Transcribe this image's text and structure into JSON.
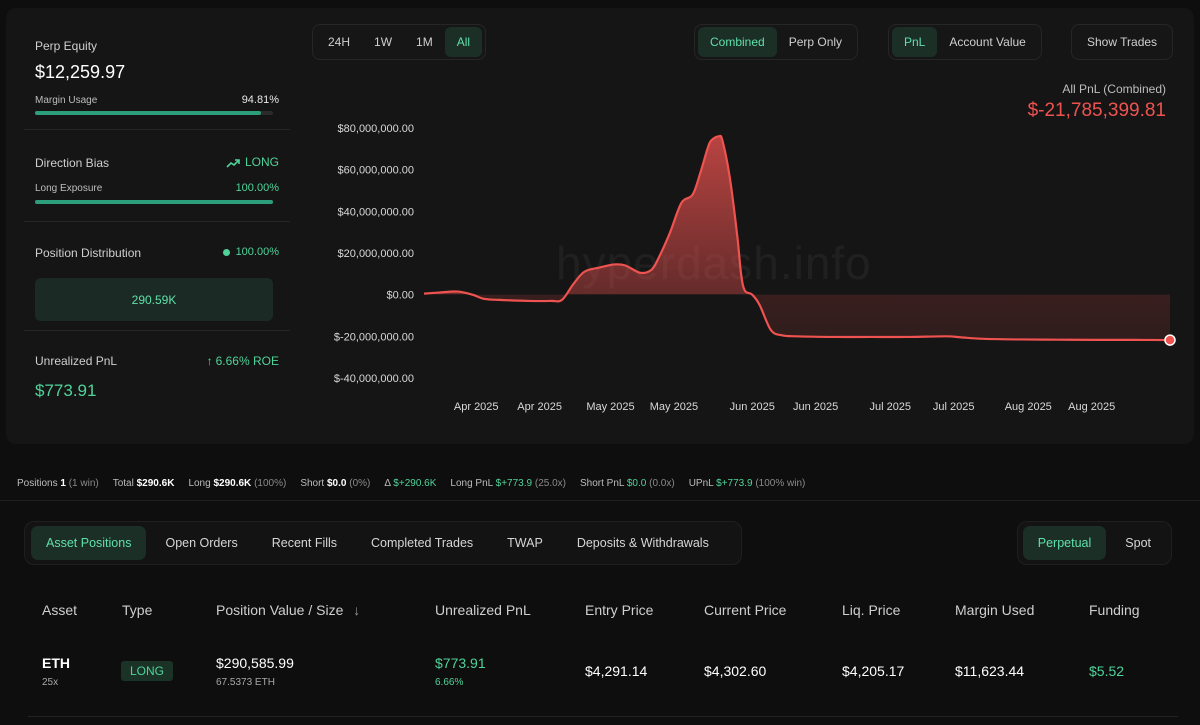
{
  "left_panel": {
    "perp_equity_label": "Perp Equity",
    "perp_equity_value": "$12,259.97",
    "margin_usage_label": "Margin Usage",
    "margin_usage_value": "94.81%",
    "margin_usage_fraction": 0.9481,
    "direction_bias_label": "Direction Bias",
    "direction_bias_value": "LONG",
    "long_exposure_label": "Long Exposure",
    "long_exposure_value": "100.00%",
    "long_exposure_fraction": 1.0,
    "position_distribution_label": "Position Distribution",
    "position_distribution_value": "100.00%",
    "position_distribution_amount": "290.59K",
    "unrealized_pnl_label": "Unrealized PnL",
    "roe_value": "6.66% ROE",
    "unrealized_pnl_value": "$773.91"
  },
  "chart_controls": {
    "time_ranges": [
      "24H",
      "1W",
      "1M",
      "All"
    ],
    "active_time_range": "All",
    "modes": [
      "Combined",
      "Perp Only"
    ],
    "active_mode": "Combined",
    "metrics": [
      "PnL",
      "Account Value"
    ],
    "active_metric": "PnL",
    "show_trades_label": "Show Trades"
  },
  "pnl_caption": "All PnL (Combined)",
  "pnl_value": "$-21,785,399.81",
  "watermark_text": "hyperdash.info",
  "chart_data": {
    "type": "area",
    "title": "",
    "xlabel": "",
    "ylabel": "",
    "ylim": [
      -40000000,
      80000000
    ],
    "y_ticks": [
      80000000,
      60000000,
      40000000,
      20000000,
      0,
      -20000000,
      -40000000
    ],
    "y_tick_labels": [
      "$80,000,000.00",
      "$60,000,000.00",
      "$40,000,000.00",
      "$20,000,000.00",
      "$0.00",
      "$-20,000,000.00",
      "$-40,000,000.00"
    ],
    "x_tick_labels": [
      "Apr 2025",
      "Apr 2025",
      "May 2025",
      "May 2025",
      "Jun 2025",
      "Jun 2025",
      "Jul 2025",
      "Jul 2025",
      "Aug 2025",
      "Aug 2025"
    ],
    "x_tick_fractions": [
      0.07,
      0.155,
      0.25,
      0.335,
      0.44,
      0.525,
      0.625,
      0.71,
      0.81,
      0.895
    ],
    "series": [
      {
        "color": "#ef5350",
        "x": [
          0,
          0.02,
          0.045,
          0.065,
          0.08,
          0.1,
          0.14,
          0.17,
          0.185,
          0.2,
          0.215,
          0.235,
          0.255,
          0.27,
          0.29,
          0.305,
          0.315,
          0.33,
          0.345,
          0.36,
          0.37,
          0.38,
          0.385,
          0.395,
          0.4,
          0.41,
          0.42,
          0.425,
          0.43,
          0.44,
          0.45,
          0.465,
          0.48,
          0.5,
          0.55,
          0.6,
          0.65,
          0.7,
          0.72,
          0.75,
          0.8,
          0.85,
          0.9,
          0.95,
          1.0
        ],
        "y": [
          0.5,
          1,
          1.5,
          0,
          -2,
          -2.5,
          -3,
          -3,
          -2.5,
          5,
          11,
          13,
          14.5,
          14,
          10.5,
          12,
          18,
          30,
          44,
          48,
          58,
          70,
          74,
          76,
          74,
          56,
          28,
          10,
          2,
          0,
          -5,
          -17,
          -19.5,
          -20,
          -20.3,
          -20.3,
          -20.3,
          -20,
          -20.5,
          -21.2,
          -21.5,
          -21.6,
          -21.7,
          -21.7,
          -21.8
        ]
      }
    ]
  },
  "summary": {
    "positions_label": "Positions",
    "positions_value": "1",
    "positions_note": "(1 win)",
    "total_label": "Total",
    "total_value": "$290.6K",
    "long_label": "Long",
    "long_value": "$290.6K",
    "long_note": "(100%)",
    "short_label": "Short",
    "short_value": "$0.0",
    "short_note": "(0%)",
    "delta_label": "Δ",
    "delta_value": "$+290.6K",
    "long_pnl_label": "Long PnL",
    "long_pnl_value": "$+773.9",
    "long_pnl_note": "(25.0x)",
    "short_pnl_label": "Short PnL",
    "short_pnl_value": "$0.0",
    "short_pnl_note": "(0.0x)",
    "upnl_label": "UPnL",
    "upnl_value": "$+773.9",
    "upnl_note": "(100% win)"
  },
  "tabs": [
    "Asset Positions",
    "Open Orders",
    "Recent Fills",
    "Completed Trades",
    "TWAP",
    "Deposits & Withdrawals"
  ],
  "active_tab": "Asset Positions",
  "market_types": [
    "Perpetual",
    "Spot"
  ],
  "active_market_type": "Perpetual",
  "table": {
    "headers": {
      "asset": "Asset",
      "type": "Type",
      "position_value": "Position Value / Size",
      "sort_icon": "↓",
      "unrealized_pnl": "Unrealized PnL",
      "entry_price": "Entry Price",
      "current_price": "Current Price",
      "liq_price": "Liq. Price",
      "margin_used": "Margin Used",
      "funding": "Funding"
    },
    "rows": [
      {
        "asset": "ETH",
        "leverage": "25x",
        "type": "LONG",
        "position_value": "$290,585.99",
        "size": "67.5373 ETH",
        "unrealized_pnl": "$773.91",
        "unrealized_pnl_pct": "6.66%",
        "entry_price": "$4,291.14",
        "current_price": "$4,302.60",
        "liq_price": "$4,205.17",
        "margin_used": "$11,623.44",
        "funding": "$5.52"
      }
    ]
  }
}
